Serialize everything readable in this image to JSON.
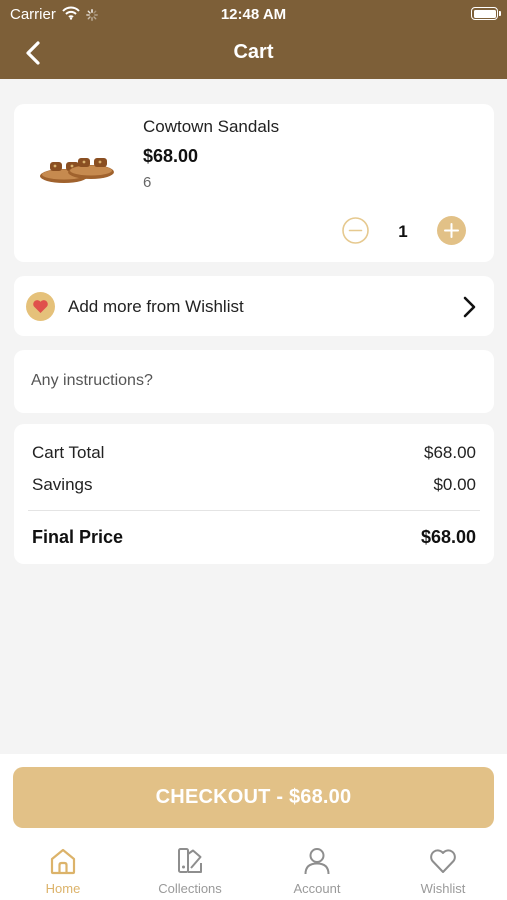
{
  "status_bar": {
    "carrier": "Carrier",
    "time": "12:48 AM"
  },
  "nav": {
    "title": "Cart",
    "back_icon": "chevron-left-icon"
  },
  "cart_item": {
    "name": "Cowtown Sandals",
    "price": "$68.00",
    "variant": "6",
    "quantity": "1"
  },
  "wishlist": {
    "label": "Add more from Wishlist",
    "icon": "heart-icon"
  },
  "instructions": {
    "placeholder": "Any instructions?"
  },
  "summary": {
    "cart_total_label": "Cart Total",
    "cart_total_value": "$68.00",
    "savings_label": "Savings",
    "savings_value": "$0.00",
    "final_label": "Final Price",
    "final_value": "$68.00"
  },
  "checkout": {
    "label": "CHECKOUT - $68.00"
  },
  "tabs": [
    {
      "label": "Home",
      "icon": "home-icon",
      "active": true
    },
    {
      "label": "Collections",
      "icon": "collections-icon",
      "active": false
    },
    {
      "label": "Account",
      "icon": "account-icon",
      "active": false
    },
    {
      "label": "Wishlist",
      "icon": "heart-outline-icon",
      "active": false
    }
  ],
  "colors": {
    "header": "#7d5f38",
    "accent": "#e2c187",
    "active_tab": "#dcb36a",
    "background": "#f4f4f4"
  }
}
